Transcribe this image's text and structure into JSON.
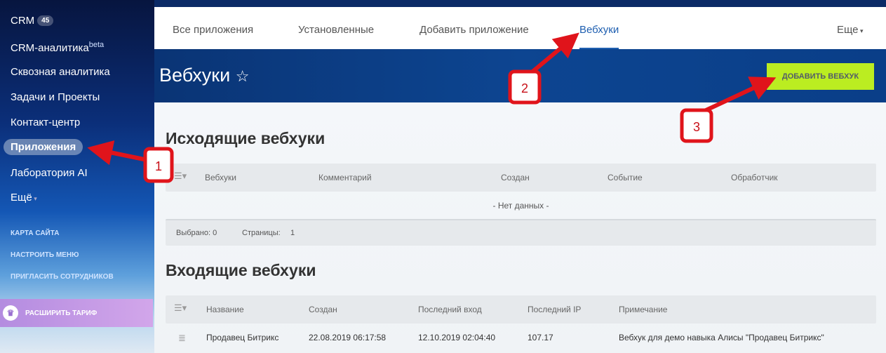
{
  "sidebar": {
    "items": [
      {
        "label": "CRM",
        "badge": "45"
      },
      {
        "label": "CRM-аналитика",
        "sup": "beta"
      },
      {
        "label": "Сквозная аналитика"
      },
      {
        "label": "Задачи и Проекты"
      },
      {
        "label": "Контакт-центр"
      },
      {
        "label": "Приложения"
      },
      {
        "label": "Лаборатория AI"
      },
      {
        "label": "Ещё"
      }
    ],
    "links": [
      "КАРТА САЙТА",
      "НАСТРОИТЬ МЕНЮ",
      "ПРИГЛАСИТЬ СОТРУДНИКОВ"
    ],
    "upgrade": "РАСШИРИТЬ ТАРИФ"
  },
  "tabs": [
    "Все приложения",
    "Установленные",
    "Добавить приложение",
    "Вебхуки"
  ],
  "more": "Еще",
  "header": {
    "title": "Вебхуки",
    "add_button": "ДОБАВИТЬ ВЕБХУК"
  },
  "outgoing": {
    "title": "Исходящие вебхуки",
    "columns": [
      "Вебхуки",
      "Комментарий",
      "Создан",
      "Событие",
      "Обработчик"
    ],
    "empty": "- Нет данных -",
    "selected": "Выбрано: 0",
    "pages_label": "Страницы:",
    "pages": "1"
  },
  "incoming": {
    "title": "Входящие вебхуки",
    "columns": [
      "Название",
      "Создан",
      "Последний вход",
      "Последний IP",
      "Примечание"
    ],
    "rows": [
      [
        "Продавец Битрикс",
        "22.08.2019 06:17:58",
        "12.10.2019 02:04:40",
        "107.17",
        "Вебхук для демо навыка Алисы \"Продавец Битрикс\""
      ]
    ]
  },
  "annotations": [
    "1",
    "2",
    "3"
  ],
  "colors": {
    "accent": "#1f5fb0",
    "button": "#bbed21",
    "callout": "#e0141b"
  }
}
